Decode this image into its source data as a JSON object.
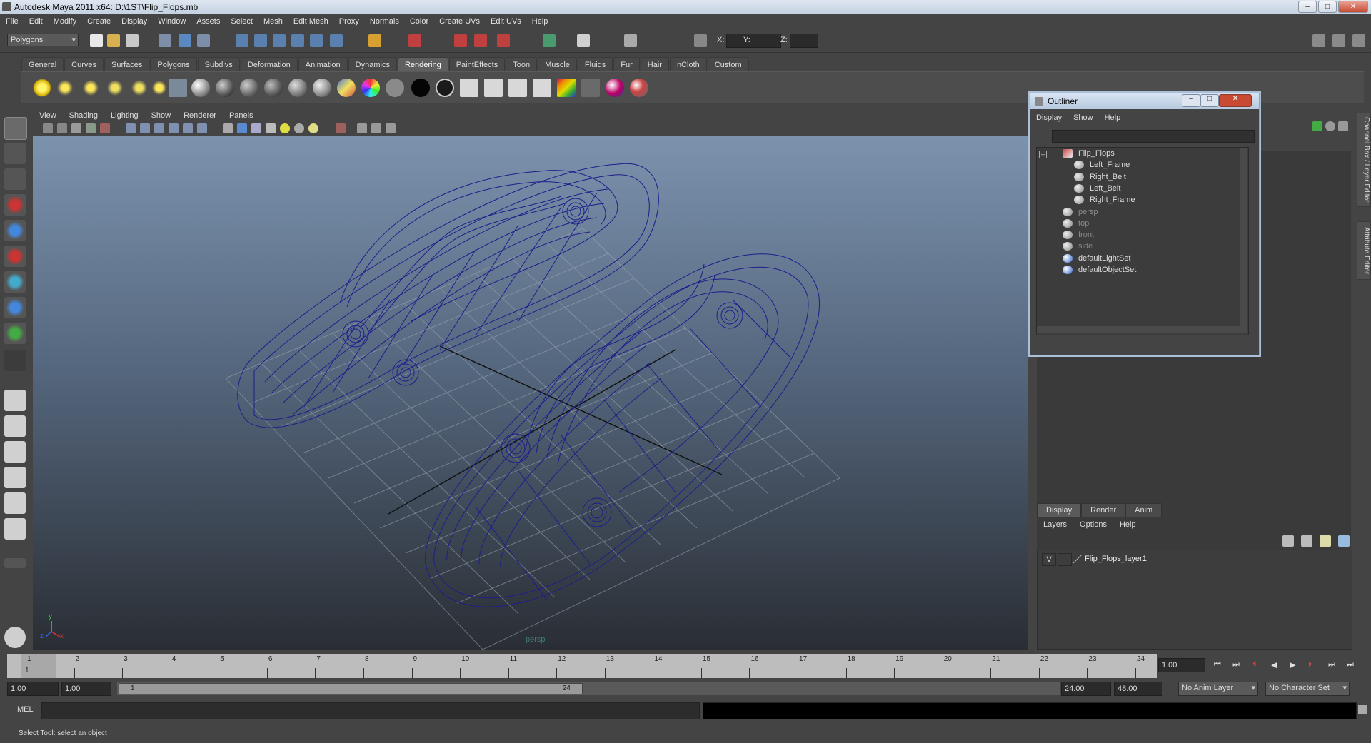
{
  "window": {
    "title": "Autodesk Maya 2011 x64: D:\\1ST\\Flip_Flops.mb",
    "buttons": [
      "–",
      "□",
      "✕"
    ]
  },
  "menubar": [
    "File",
    "Edit",
    "Modify",
    "Create",
    "Display",
    "Window",
    "Assets",
    "Select",
    "Mesh",
    "Edit Mesh",
    "Proxy",
    "Normals",
    "Color",
    "Create UVs",
    "Edit UVs",
    "Help"
  ],
  "statusline": {
    "menu_set": "Polygons",
    "xyz": {
      "x_label": "X:",
      "y_label": "Y:",
      "z_label": "Z:",
      "x": "",
      "y": "",
      "z": ""
    }
  },
  "shelf": {
    "tabs": [
      "General",
      "Curves",
      "Surfaces",
      "Polygons",
      "Subdivs",
      "Deformation",
      "Animation",
      "Dynamics",
      "Rendering",
      "PaintEffects",
      "Toon",
      "Muscle",
      "Fluids",
      "Fur",
      "Hair",
      "nCloth",
      "Custom"
    ],
    "active_tab": "Rendering",
    "colors": {
      "sphere_dark": "#1a1a1a",
      "sphere_gray": "#8a8a8a",
      "sphere_white": "#d0d0d0",
      "ramp1": "#c9a65c",
      "ramp2": "#c0413a"
    }
  },
  "viewport": {
    "menu": [
      "View",
      "Shading",
      "Lighting",
      "Show",
      "Renderer",
      "Panels"
    ],
    "camera_label": "persp",
    "axis": {
      "y": "y",
      "x": "x",
      "z": "z"
    },
    "wire_color": "#1d1d8c"
  },
  "outliner": {
    "title": "Outliner",
    "menu": [
      "Display",
      "Show",
      "Help"
    ],
    "items": [
      {
        "label": "Flip_Flops",
        "indent": 0,
        "dim": false,
        "icon": "group-icon"
      },
      {
        "label": "Left_Frame",
        "indent": 1,
        "dim": false,
        "icon": "mesh-icon"
      },
      {
        "label": "Right_Belt",
        "indent": 1,
        "dim": false,
        "icon": "mesh-icon"
      },
      {
        "label": "Left_Belt",
        "indent": 1,
        "dim": false,
        "icon": "mesh-icon"
      },
      {
        "label": "Right_Frame",
        "indent": 1,
        "dim": false,
        "icon": "mesh-icon"
      },
      {
        "label": "persp",
        "indent": 0,
        "dim": true,
        "icon": "camera-icon"
      },
      {
        "label": "top",
        "indent": 0,
        "dim": true,
        "icon": "camera-icon"
      },
      {
        "label": "front",
        "indent": 0,
        "dim": true,
        "icon": "camera-icon"
      },
      {
        "label": "side",
        "indent": 0,
        "dim": true,
        "icon": "camera-icon"
      },
      {
        "label": "defaultLightSet",
        "indent": 0,
        "dim": false,
        "icon": "set-icon"
      },
      {
        "label": "defaultObjectSet",
        "indent": 0,
        "dim": false,
        "icon": "set-icon"
      }
    ]
  },
  "sidetabs": [
    "Channel Box / Layer Editor",
    "Attribute Editor"
  ],
  "layer_editor": {
    "tabs": [
      "Display",
      "Render",
      "Anim"
    ],
    "active_tab": "Display",
    "menu": [
      "Layers",
      "Options",
      "Help"
    ],
    "layer": {
      "visible": "V",
      "name": "Flip_Flops_layer1"
    }
  },
  "timeline": {
    "frames": [
      "1",
      "2",
      "3",
      "4",
      "5",
      "6",
      "7",
      "8",
      "9",
      "10",
      "11",
      "12",
      "13",
      "14",
      "15",
      "16",
      "17",
      "18",
      "19",
      "20",
      "21",
      "22",
      "23",
      "24"
    ],
    "current_frame": "1.00",
    "start": "1.00",
    "start2": "1.00",
    "range_start": "1",
    "range_end": "24",
    "end": "24.00",
    "end2": "48.00",
    "anim_layer": "No Anim Layer",
    "char_set": "No Character Set"
  },
  "cmdline": {
    "label": "MEL"
  },
  "helpline": {
    "text": "Select Tool: select an object"
  }
}
